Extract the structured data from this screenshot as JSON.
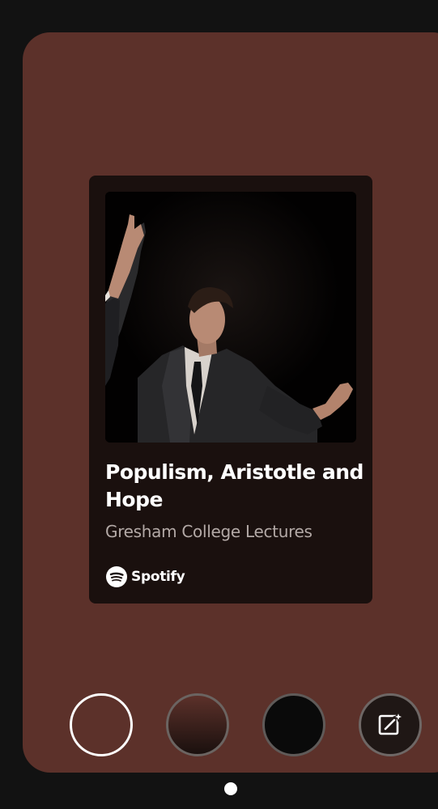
{
  "card": {
    "title": "Populism, Aristotle and Hope",
    "subtitle": "Gresham College Lectures",
    "brand": "Spotify"
  },
  "colors": {
    "background": "#121212",
    "panel": "#5c312a",
    "card": "#1a100e",
    "subtitle": "#b3a9a6"
  },
  "swatches": [
    {
      "name": "brown-solid",
      "selected": true
    },
    {
      "name": "brown-gradient",
      "selected": false
    },
    {
      "name": "black",
      "selected": false
    },
    {
      "name": "custom-edit",
      "icon": "edit-sparkle-icon",
      "selected": false
    }
  ],
  "pager": {
    "current": 1,
    "total": 1
  }
}
